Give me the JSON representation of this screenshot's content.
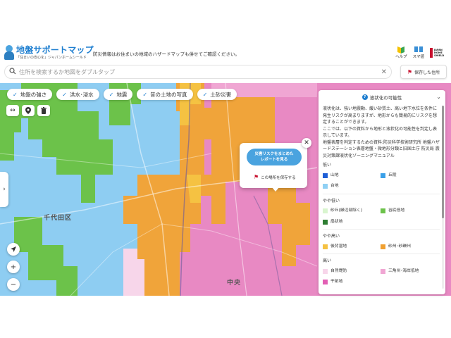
{
  "header": {
    "logo_title": "地盤サポートマップ",
    "logo_sub": "「住まいの安心を」ジャパンホームシールド",
    "notice": "防災情報はお住まいの地域のハザードマップも併せてご確認ください。",
    "help_label": "ヘルプ",
    "sp_label": "スマ値",
    "jhs_text": "JAPAN HOME SHIELD"
  },
  "search": {
    "placeholder": "住所を検索するか地図をダブルタップ",
    "value": ""
  },
  "saved_places_label": "保存した住所",
  "layers": [
    {
      "label": "地盤の強さ"
    },
    {
      "label": "洪水･浸水"
    },
    {
      "label": "地震"
    },
    {
      "label": "昔の土地の写真"
    },
    {
      "label": "土砂災害"
    }
  ],
  "map_labels": {
    "ward1": "千代田区",
    "ward2": "中央"
  },
  "popup": {
    "report_line1": "災害リスクをまとめた",
    "report_line2": "レポートを見る",
    "save_label": "この場所を保存する"
  },
  "panel": {
    "title": "液状化の可能性",
    "desc1": "液状化は、強い地震動、緩い砂質土、高い地下水位を条件に発生リスクが高まりますが、地形からも簡易的にリスクを想定することができます。",
    "desc2": "ここでは、以下の資料から地形と液状化の可能性を判定し表示しています。",
    "desc3": "地盤表層を判定するための資料:防災科学技術研究所 地盤ハザードステーション表層地盤・微地形分類と旧国土庁 防災局 震災対策課液状化ゾーニングマニュアル",
    "sections": [
      {
        "title": "低い",
        "items": [
          {
            "label": "山地",
            "color": "#1f5fd6"
          },
          {
            "label": "丘陵",
            "color": "#3aa0e8"
          },
          {
            "label": "台地",
            "color": "#8fd0f4"
          }
        ]
      },
      {
        "title": "やや低い",
        "items": [
          {
            "label": "砂丘(縁辺部除く)",
            "color": "#d9f5cf"
          },
          {
            "label": "谷底低地",
            "color": "#6cc24a"
          },
          {
            "label": "扇状地",
            "color": "#2e7d32"
          }
        ]
      },
      {
        "title": "やや高い",
        "items": [
          {
            "label": "後背湿地",
            "color": "#f5c242"
          },
          {
            "label": "砂州･砂礫州",
            "color": "#f0a030"
          }
        ]
      },
      {
        "title": "高い",
        "items": [
          {
            "label": "自然堤防",
            "color": "#f7d6ea"
          },
          {
            "label": "三角州･海岸低地",
            "color": "#f0a6d3"
          },
          {
            "label": "干拓地",
            "color": "#e25fb4"
          }
        ]
      }
    ]
  },
  "colors": {
    "accent": "#1f7fd0",
    "red": "#c8102e"
  }
}
